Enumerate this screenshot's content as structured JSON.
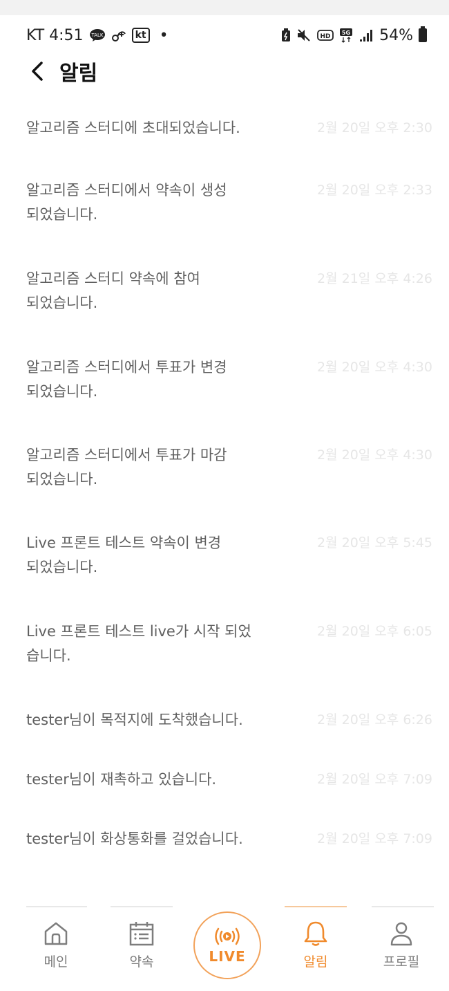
{
  "status_bar": {
    "carrier_time": "KT 4:51",
    "bullet": "•",
    "kt_icon_text": "kt",
    "battery": "54%"
  },
  "header": {
    "title": "알림"
  },
  "notifications": [
    {
      "message": "알고리즘 스터디에 초대되었습니다.",
      "time": "2월 20일 오후 2:30"
    },
    {
      "message": "알고리즘 스터디에서 약속이 생성되었습니다.",
      "time": "2월 20일 오후 2:33"
    },
    {
      "message": "알고리즘 스터디 약속에 참여되었습니다.",
      "time": "2월 21일 오후 4:26"
    },
    {
      "message": "알고리즘 스터디에서 투표가 변경되었습니다.",
      "time": "2월 20일 오후 4:30"
    },
    {
      "message": "알고리즘 스터디에서 투표가 마감되었습니다.",
      "time": "2월 20일 오후 4:30"
    },
    {
      "message": "Live 프론트 테스트 약속이 변경되었습니다.",
      "time": "2월 20일 오후 5:45"
    },
    {
      "message": "Live 프론트 테스트 live가 시작 되었습니다.",
      "time": "2월 20일 오후 6:05"
    },
    {
      "message": "tester님이 목적지에 도착했습니다.",
      "time": "2월 20일 오후 6:26"
    },
    {
      "message": "tester님이 재촉하고 있습니다.",
      "time": "2월 20일 오후 7:09"
    },
    {
      "message": "tester님이 화상통화를 걸었습니다.",
      "time": "2월 20일 오후 7:09"
    }
  ],
  "tabbar": {
    "home": "메인",
    "schedule": "약속",
    "live": "LIVE",
    "alarm": "알림",
    "profile": "프로필",
    "active": "alarm",
    "accent_color": "#f08a2c"
  }
}
